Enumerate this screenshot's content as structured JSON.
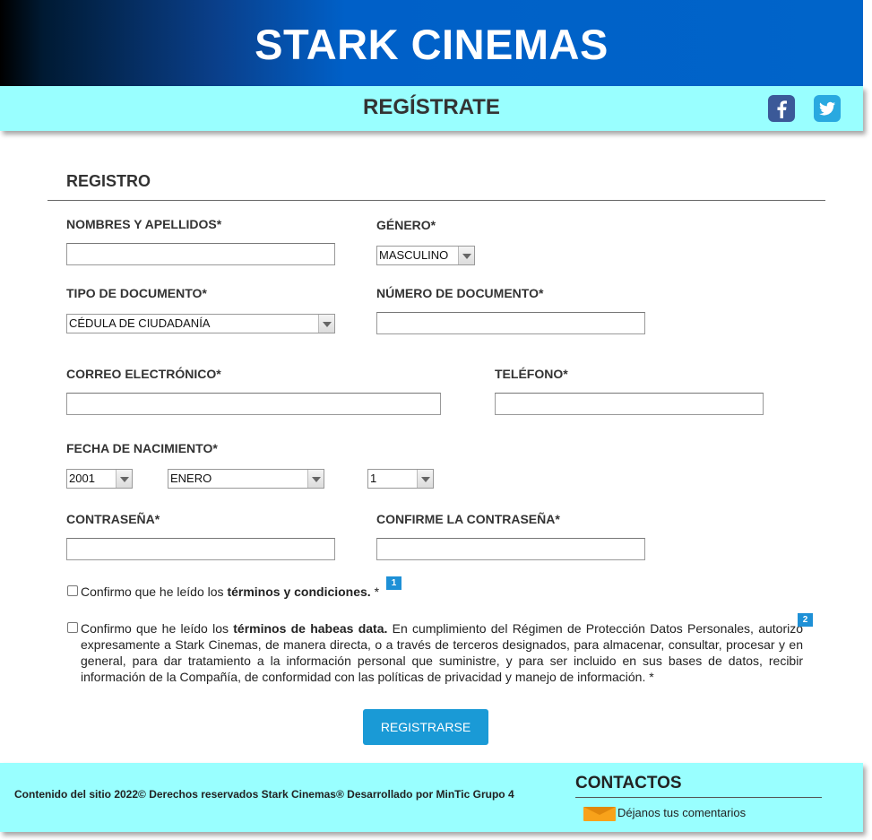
{
  "header": {
    "title": "STARK CINEMAS"
  },
  "subbar": {
    "title": "REGÍSTRATE"
  },
  "form": {
    "section_title": "REGISTRO",
    "full_name_label": "NOMBRES Y APELLIDOS*",
    "gender_label": "GÉNERO*",
    "gender_value": "MASCULINO",
    "doc_type_label": "TIPO DE DOCUMENTO*",
    "doc_type_value": "CÉDULA DE CIUDADANÍA",
    "doc_number_label": "NÚMERO DE DOCUMENTO*",
    "email_label": "CORREO ELECTRÓNICO*",
    "phone_label": "TELÉFONO*",
    "birth_label": "FECHA DE NACIMIENTO*",
    "birth_year": "2001",
    "birth_month": "ENERO",
    "birth_day": "1",
    "password_label": "CONTRASEÑA*",
    "confirm_password_label": "CONFIRME LA CONTRASEÑA*",
    "terms_prefix": "Confirmo que he leído los ",
    "terms_bold": "términos y condiciones.",
    "terms_suffix": " *",
    "terms_badge": "1",
    "habeas_prefix": "Confirmo que he leído los ",
    "habeas_bold": "términos de habeas data.",
    "habeas_suffix": " En cumplimiento del Régimen de Protección Datos Personales, autorizo expresamente a Stark Cinemas, de manera directa, o a través de terceros designados, para almacenar, consultar, procesar y en general, para dar tratamiento a la información personal que suministre, y para ser incluido en sus bases de datos, recibir información de la Compañía, de conformidad con las políticas de privacidad y manejo de información. *",
    "habeas_badge": "2",
    "submit_label": "REGISTRARSE"
  },
  "footer": {
    "copyright": "Contenido del sitio 2022© Derechos reservados Stark Cinemas® Desarrollado por MinTic Grupo 4",
    "contacts_title": "CONTACTOS",
    "feedback_link": "Déjanos tus comentarios"
  },
  "icons": [
    "facebook-icon",
    "twitter-icon",
    "mail-icon",
    "chevron-down-icon"
  ],
  "colors": {
    "header_blue": "#0064c9",
    "accent_cyan": "#99ffff",
    "button_blue": "#1a9ad6"
  }
}
